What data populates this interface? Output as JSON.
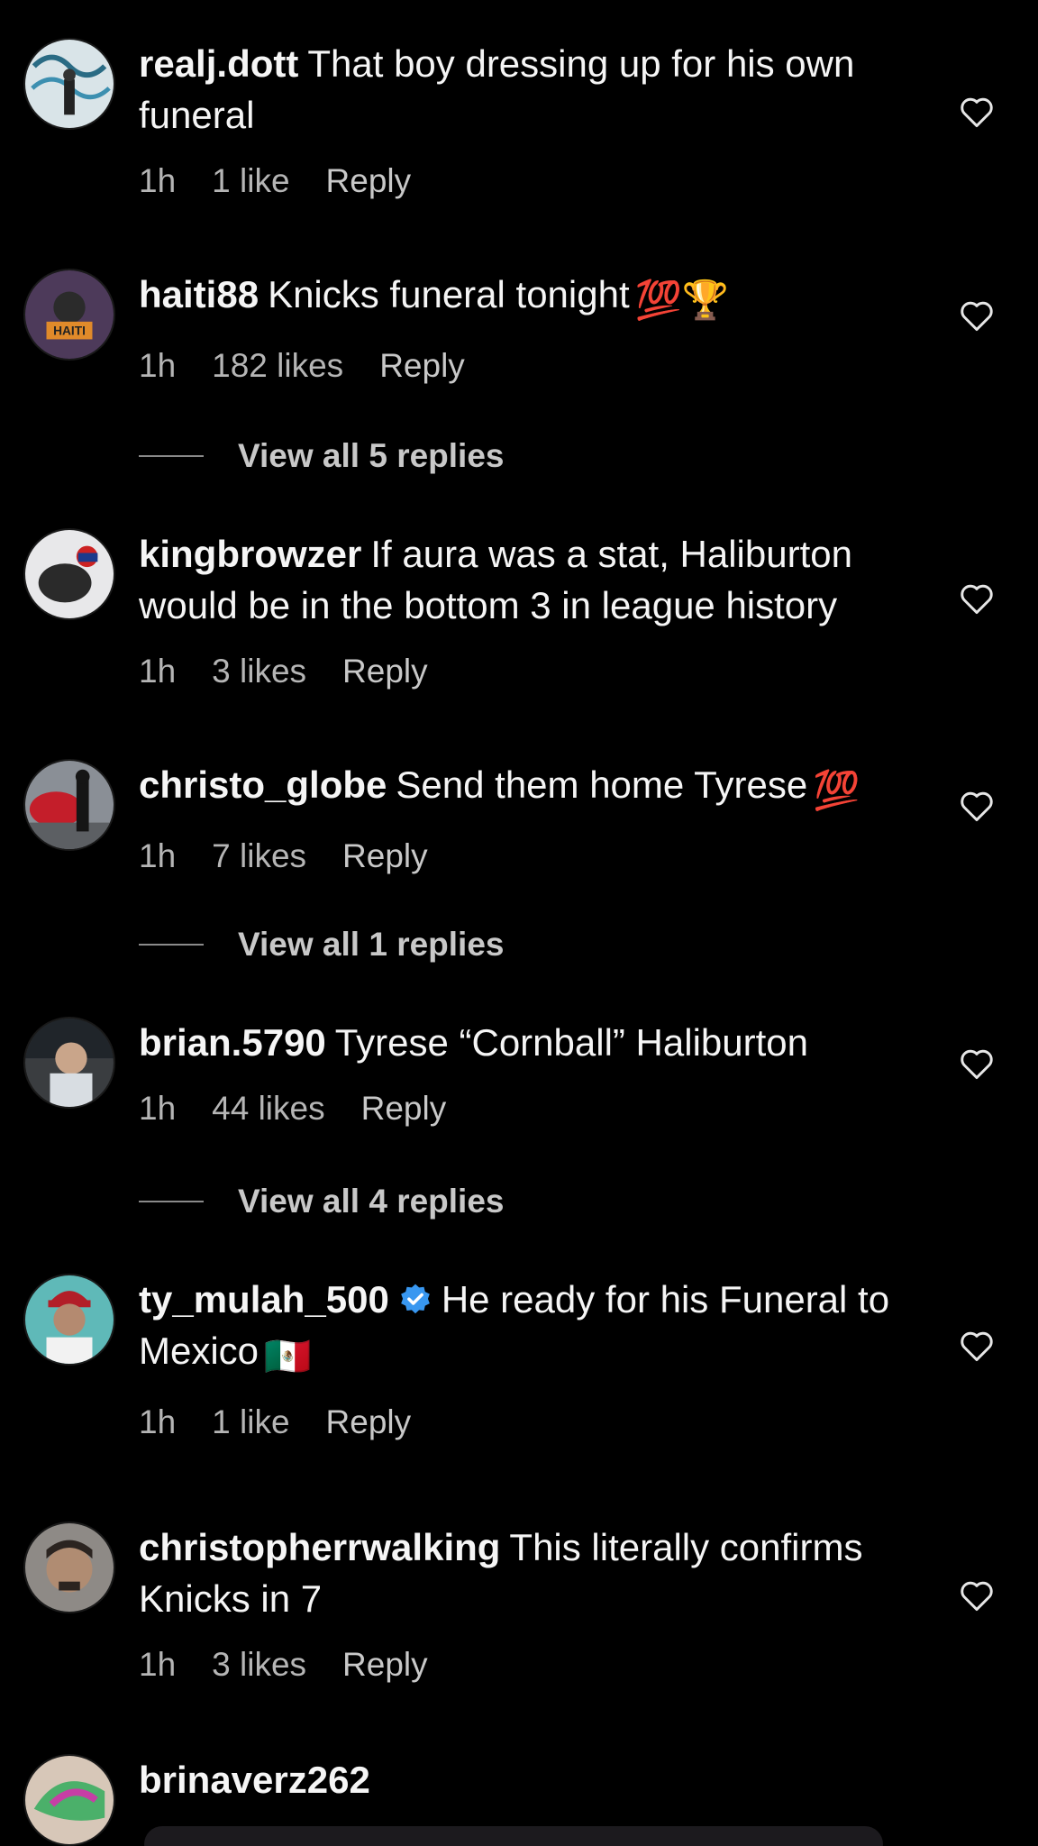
{
  "comments": [
    {
      "username": "realj.dott",
      "text": "That boy dressing up for his own funeral",
      "time": "1h",
      "likes": "1 like",
      "reply": "Reply"
    },
    {
      "username": "haiti88",
      "text": "Knicks funeral tonight",
      "emoji": "💯🏆",
      "time": "1h",
      "likes": "182 likes",
      "reply": "Reply"
    },
    {
      "username": "kingbrowzer",
      "text": "If aura was a stat, Haliburton would be in the bottom 3 in league history",
      "time": "1h",
      "likes": "3 likes",
      "reply": "Reply"
    },
    {
      "username": "christo_globe",
      "text": "Send them home Tyrese",
      "emoji": "💯",
      "time": "1h",
      "likes": "7 likes",
      "reply": "Reply"
    },
    {
      "username": "brian.5790",
      "text": "Tyrese “Cornball” Haliburton",
      "time": "1h",
      "likes": "44 likes",
      "reply": "Reply"
    },
    {
      "username": "ty_mulah_500",
      "text": "He ready for his Funeral to Mexico",
      "emoji": "🇲🇽",
      "time": "1h",
      "likes": "1 like",
      "reply": "Reply"
    },
    {
      "username": "christopherrwalking",
      "text": "This literally confirms Knicks in 7",
      "time": "1h",
      "likes": "3 likes",
      "reply": "Reply"
    },
    {
      "username": "brinaverz262",
      "text": ""
    }
  ],
  "view_replies": [
    "View all 5 replies",
    "View all 1 replies",
    "View all 4 replies"
  ],
  "colors": {
    "background": "#000000",
    "text": "#f5f5f5",
    "meta": "#b5b5b5",
    "verified": "#3897f0"
  }
}
